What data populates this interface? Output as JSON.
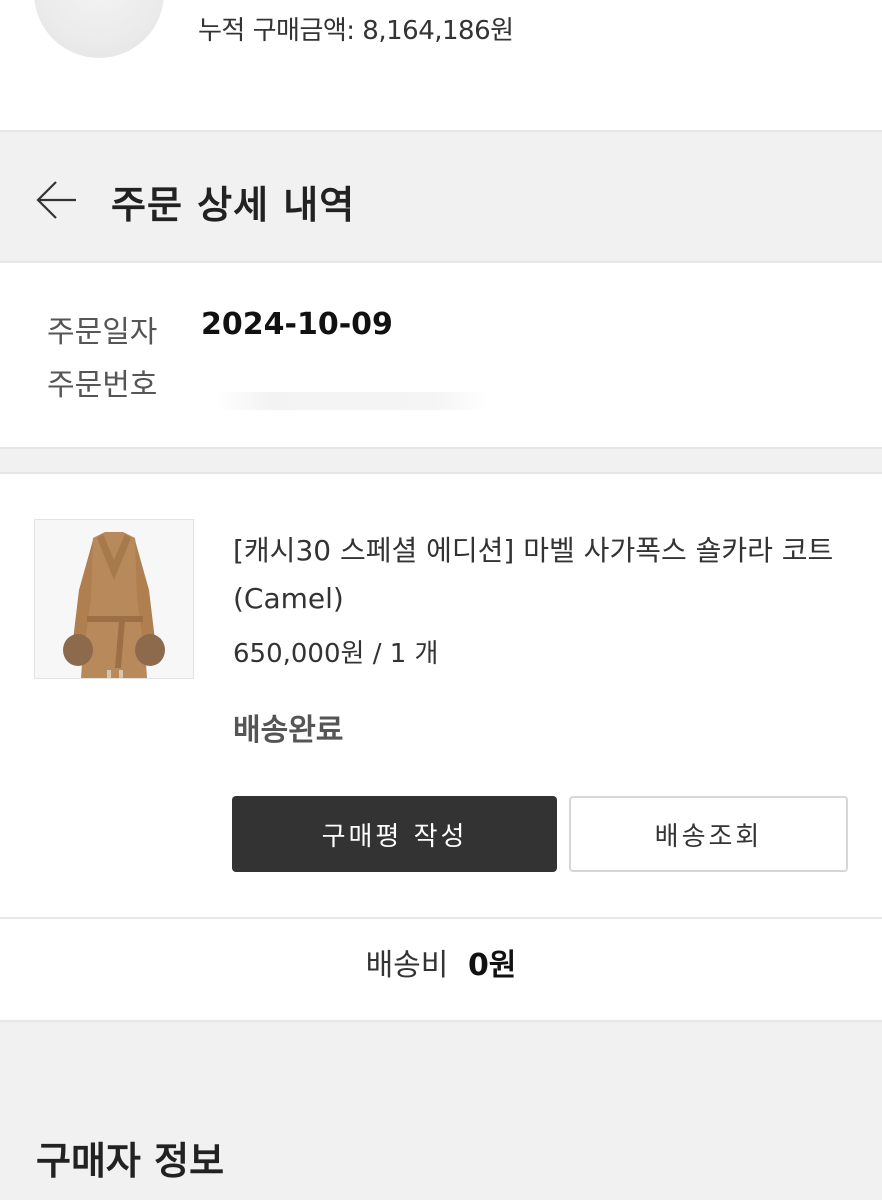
{
  "profile": {
    "total_purchase": "누적 구매금액: 8,164,186원"
  },
  "header": {
    "title": "주문 상세 내역"
  },
  "order": {
    "date_label": "주문일자",
    "date_value": "2024-10-09",
    "number_label": "주문번호"
  },
  "product": {
    "name": "[캐시30 스페셜 에디션] 마벨 사가폭스 숄카라 코트 (Camel)",
    "price_qty": "650,000원 / 1 개",
    "status": "배송완료",
    "review_button": "구매평 작성",
    "tracking_button": "배송조회"
  },
  "shipping": {
    "label": "배송비",
    "value": "0원"
  },
  "buyer": {
    "title": "구매자 정보"
  },
  "colors": {
    "primary_button": "#333333",
    "section_gray": "#f1f1f1",
    "coat": "#b8895a"
  },
  "icons": {
    "back": "arrow-left-icon"
  }
}
